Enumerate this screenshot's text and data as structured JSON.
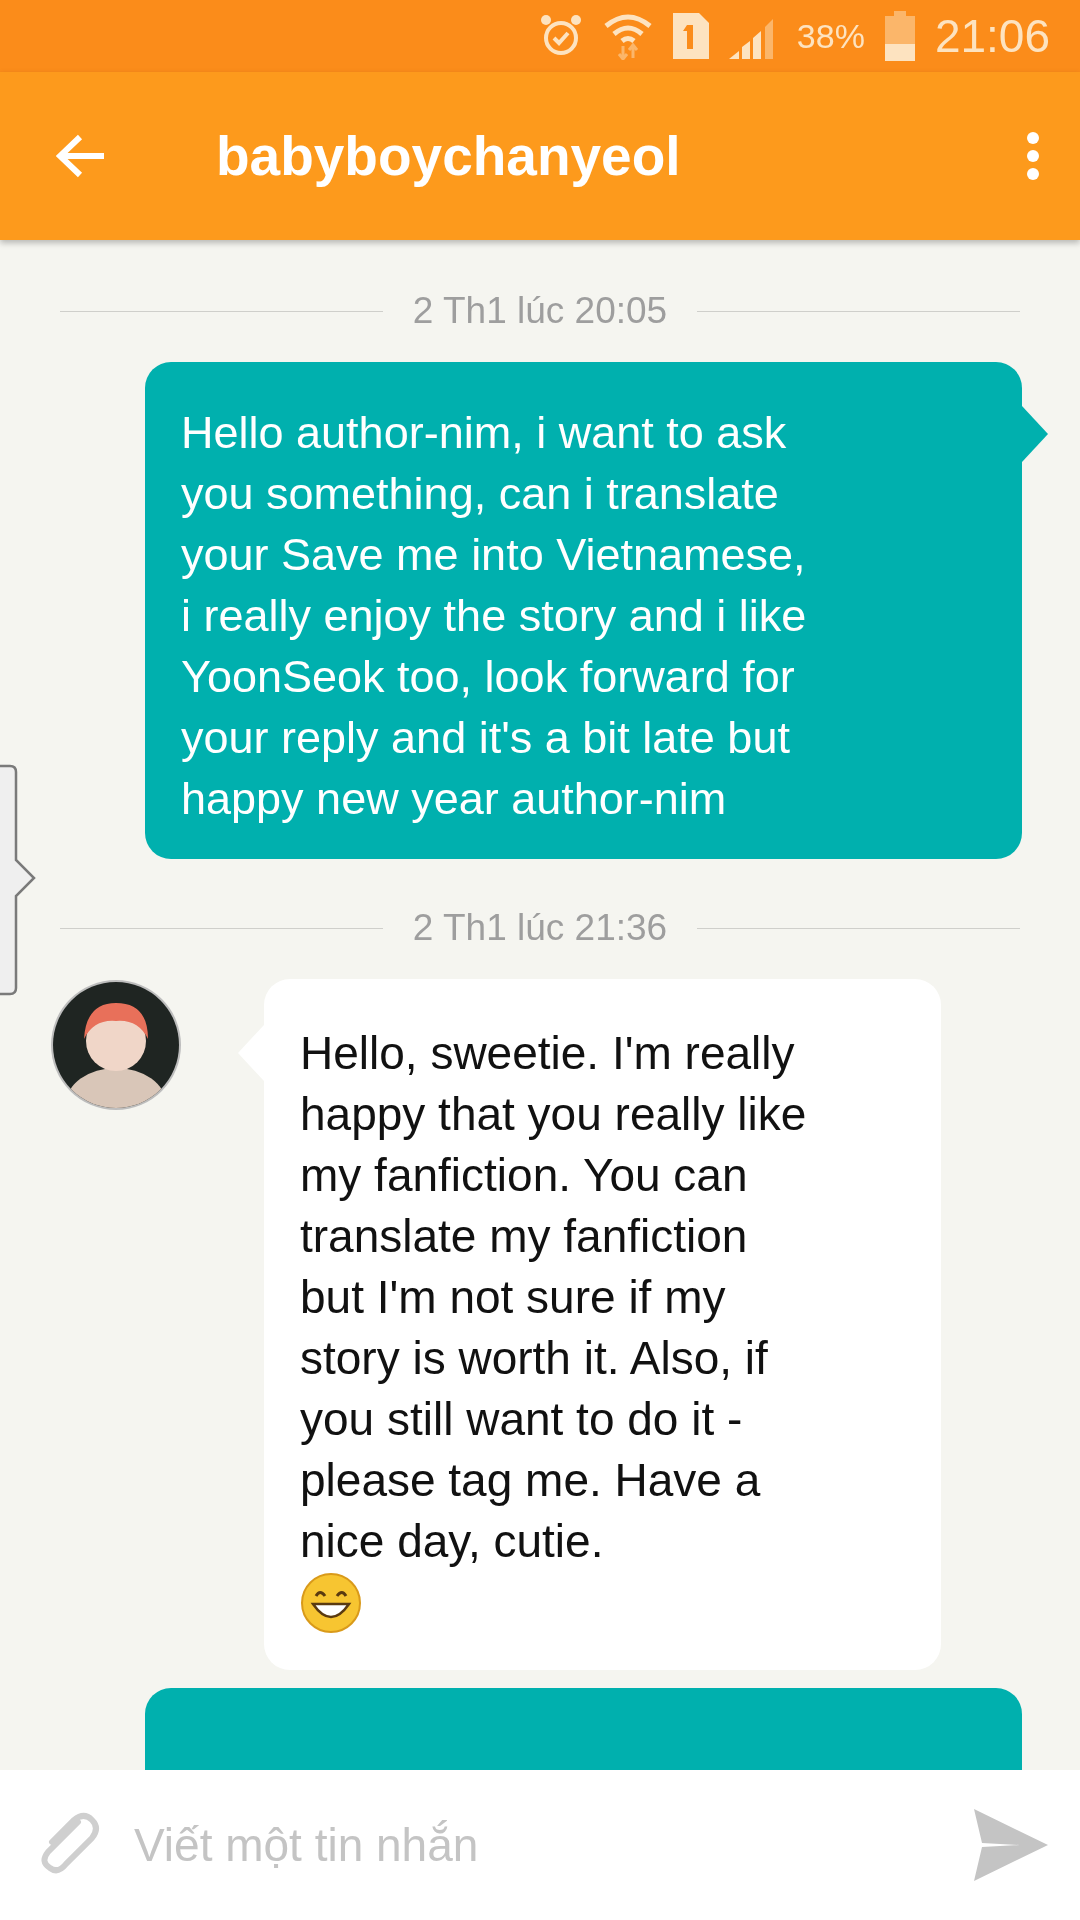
{
  "status_bar": {
    "battery": "38%",
    "time": "21:06"
  },
  "app_bar": {
    "title": "babyboychanyeol"
  },
  "messages": [
    {
      "kind": "date",
      "text": "2 Th1 lúc 20:05"
    },
    {
      "kind": "outgoing",
      "text": "Hello author-nim, i want to ask\nyou something, can i translate\nyour Save me into Vietnamese,\ni really enjoy the story and i like\nYoonSeok too, look forward for\nyour reply and it's a bit late but\nhappy new year author-nim"
    },
    {
      "kind": "date",
      "text": "2 Th1 lúc 21:36"
    },
    {
      "kind": "incoming",
      "text": "Hello, sweetie. I'm really\nhappy that you really like\nmy fanfiction. You can\ntranslate my fanfiction\nbut I'm not sure if my\nstory is worth it. Also, if\nyou still want to do it -\nplease tag me. Have a\nnice day, cutie.",
      "emoji": true
    },
    {
      "kind": "outgoing_cut"
    }
  ],
  "composer": {
    "placeholder": "Viết một tin nhắn"
  }
}
